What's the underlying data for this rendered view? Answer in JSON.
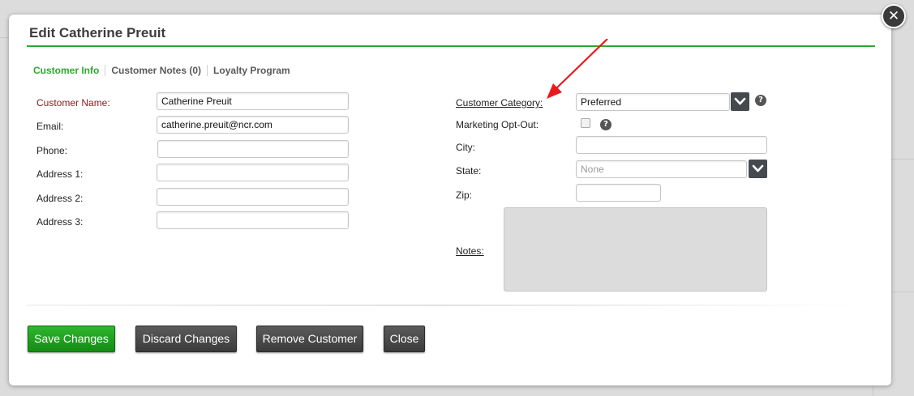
{
  "dialog": {
    "title": "Edit Catherine Preuit",
    "close_glyph": "✕"
  },
  "tabs": [
    {
      "label": "Customer Info",
      "active": true
    },
    {
      "label": "Customer Notes (0)",
      "active": false
    },
    {
      "label": "Loyalty Program",
      "active": false
    }
  ],
  "left_form": {
    "customer_name": {
      "label": "Customer Name:",
      "value": "Catherine Preuit"
    },
    "email": {
      "label": "Email:",
      "value": "catherine.preuit@ncr.com"
    },
    "phone": {
      "label": "Phone:",
      "value": ""
    },
    "address1": {
      "label": "Address 1:",
      "value": ""
    },
    "address2": {
      "label": "Address 2:",
      "value": ""
    },
    "address3": {
      "label": "Address 3:",
      "value": ""
    }
  },
  "right_form": {
    "customer_category": {
      "label": "Customer Category:",
      "value": "Preferred"
    },
    "marketing_opt_out": {
      "label": "Marketing Opt-Out:",
      "checked": false
    },
    "city": {
      "label": "City:",
      "value": ""
    },
    "state": {
      "label": "State:",
      "value": "",
      "placeholder": "None"
    },
    "zip": {
      "label": "Zip:",
      "value": ""
    },
    "notes": {
      "label": "Notes:",
      "value": ""
    }
  },
  "help_glyph": "?",
  "buttons": {
    "save": "Save Changes",
    "discard": "Discard Changes",
    "remove": "Remove Customer",
    "close": "Close"
  },
  "icons": {
    "close": "close-icon",
    "dropdown": "chevron-down-icon",
    "help": "help-icon",
    "annotation": "red-arrow-annotation"
  },
  "colors": {
    "accent_green": "#2ea82e",
    "required_label": "#8b1a1a",
    "annotation_red": "#e8191b",
    "button_dark": "#464a4f"
  }
}
